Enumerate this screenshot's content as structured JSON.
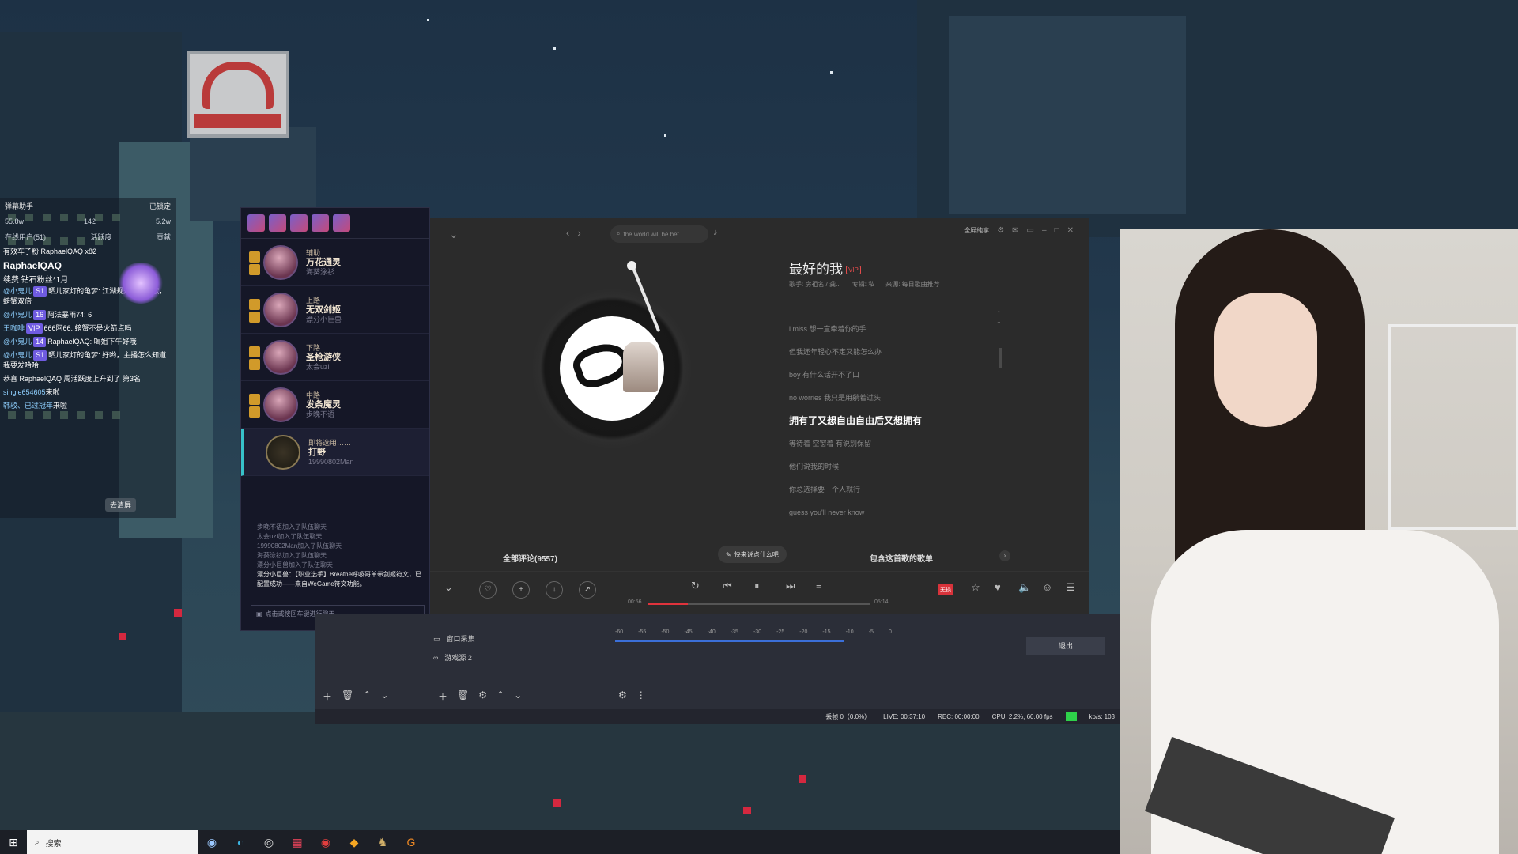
{
  "stream_panel": {
    "assistant_label": "弹幕助手",
    "lock_label": "已锁定",
    "stats": [
      "55.8w",
      "142",
      "5.2w"
    ],
    "tabs": [
      "在线用户(51)",
      "活跃度",
      "贡献"
    ],
    "top_line": "有效车子粉 RaphaelQAQ x82",
    "user_name": "RaphaelQAQ",
    "user_sub": "续费 钻石粉丝*1月",
    "chat": [
      {
        "user": "@小鬼儿",
        "tag": "S1",
        "text": "晒儿家灯的龟梦: 江湖规矩飞机应歌，螃蟹双倍"
      },
      {
        "user": "@小鬼儿",
        "tag": "16",
        "text": "阿法暴雨74: 6"
      },
      {
        "user": "王咖啡",
        "tag": "VIP",
        "text": "666阿66: 螃蟹不是火箭点吗"
      },
      {
        "user": "@小鬼儿",
        "tag": "14",
        "text": "RaphaelQAQ: 喝姐下午好哦"
      },
      {
        "user": "@小鬼儿",
        "tag": "S1",
        "text": "晒儿家灯的龟梦: 好哟，主播怎么知道我要发哈哈"
      },
      {
        "user": "",
        "tag": "",
        "text": "恭喜 RaphaelQAQ 周活跃度上升到了 第3名"
      },
      {
        "user": "single654605",
        "tag": "",
        "text": "来啦"
      },
      {
        "user": "韩驳、已过冠年",
        "tag": "",
        "text": "来啦"
      }
    ],
    "button": "去清屏"
  },
  "game_client": {
    "players": [
      {
        "role": "辅助",
        "champ": "万花通灵",
        "name": "海葵泳衫"
      },
      {
        "role": "上路",
        "champ": "无双剑姬",
        "name": "漂分小巨兽"
      },
      {
        "role": "下路",
        "champ": "圣枪游侠",
        "name": "太会uzi"
      },
      {
        "role": "中路",
        "champ": "发条魔灵",
        "name": "步晚不语"
      },
      {
        "role": "即将选用……",
        "champ": "打野",
        "name": "19990802Man"
      }
    ],
    "log": [
      "步晚不语加入了队伍聊天",
      "太会uzi加入了队伍聊天",
      "19990802Man加入了队伍聊天",
      "海葵泳衫加入了队伍聊天",
      "漂分小巨兽加入了队伍聊天"
    ],
    "log_highlight": "漂分小巨兽：【职业选手】Breathe呼吸哥单带剑姬符文，已配置成功——来自WeGame符文功能。",
    "input_placeholder": "点击或按回车键进行聊天"
  },
  "music": {
    "search_placeholder": "the world will be bet",
    "vip_label": "全屏纯享",
    "song_title": "最好的我",
    "song_tag": "VIP",
    "meta_singer": "歌手: 房祖名 / 龚...",
    "meta_album": "专辑: 私",
    "meta_source": "来源: 每日歌曲推荐",
    "lyrics": [
      "i miss 想一直牵着你的手",
      "但我还年轻心不定又能怎么办",
      "boy 有什么话开不了口",
      "no worries 我只是用躺着过头",
      "拥有了又想自由自由后又想拥有",
      "等待着 空窗着 有说别保留",
      "他们说我的时候",
      "你总选择要一个人就行",
      "guess you'll never know"
    ],
    "active_lyric_index": 4,
    "comments_label": "全部评论(9557)",
    "say_label": "快来说点什么吧",
    "playlists_label": "包含这首歌的歌单",
    "time_current": "00:56",
    "time_total": "05:14",
    "progress": 0.18,
    "quality_label": "无损"
  },
  "obs": {
    "sources": [
      "窗口采集",
      "游戏源 2"
    ],
    "mixer_scale": [
      "-60",
      "-55",
      "-50",
      "-45",
      "-40",
      "-35",
      "-30",
      "-25",
      "-20",
      "-15",
      "-10",
      "-5",
      "0"
    ],
    "exit_label": "退出",
    "status_dropped": "丢帧 0（0.0%）",
    "status_live": "LIVE: 00:37:10",
    "status_rec": "REC: 00:00:00",
    "status_cpu": "CPU: 2.2%, 60.00 fps",
    "status_kbps": "kb/s: 103"
  },
  "taskbar": {
    "search_placeholder": "搜索"
  }
}
